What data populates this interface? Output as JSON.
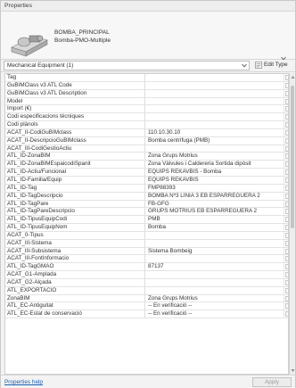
{
  "window": {
    "title": "Properties"
  },
  "type_selector": {
    "family_name": "BOMBA_PRINCIPAL",
    "type_name": "Bomba-PMO-Multiple"
  },
  "filter": {
    "selected": "Mechanical Equipment (1)",
    "edit_type_label": "Edit Type"
  },
  "parameters": [
    {
      "name": "Tag",
      "value": ""
    },
    {
      "name": "GuBIMClass v3 ATL Code",
      "value": ""
    },
    {
      "name": "GuBIMClass v3 ATL Description",
      "value": ""
    },
    {
      "name": "Model",
      "value": ""
    },
    {
      "name": "Import (€)",
      "value": ""
    },
    {
      "name": "Codi especificacions técniques",
      "value": ""
    },
    {
      "name": "Codi plànols",
      "value": ""
    },
    {
      "name": "ACAT_II-CodiGuBIMclass",
      "value": "110.10.30.10"
    },
    {
      "name": "ACAT_II-DescripcioGuBIMclass",
      "value": "Bomba centrífuga (PMB)"
    },
    {
      "name": "ACAT_III-CodiGestioActiu",
      "value": ""
    },
    {
      "name": "ATL_ID-ZonaBIM",
      "value": "Zona Grups Motrius"
    },
    {
      "name": "ATL_ID-ZonaBIMEspaicodiSpanit",
      "value": "Zona Vàlvules i Caldereria Sortida dipòsit"
    },
    {
      "name": "ATL_ID-Actiu/Funcional",
      "value": "EQUIPS REKAVBIS - Bomba"
    },
    {
      "name": "ATL_ID-Familia/Equip",
      "value": "EQUIPS REKAVBIS"
    },
    {
      "name": "ATL_ID-Tag",
      "value": "FMP88393"
    },
    {
      "name": "ATL_ID-TagDescripcio",
      "value": "BOMBA Nº3 LÍNIA 3 EB ESPARREGUERA 2"
    },
    {
      "name": "ATL_ID-TagPare",
      "value": "FB-GFG"
    },
    {
      "name": "ATL_ID-TagPareDescripcio",
      "value": "GRUPS MOTRIUS EB ESPARREGUERA 2"
    },
    {
      "name": "ATL_ID-TipusEquipCodi",
      "value": "PMB"
    },
    {
      "name": "ATL_ID-TipusEquipNom",
      "value": "Bomba"
    },
    {
      "name": "ACAT_0-Tipus",
      "value": ""
    },
    {
      "name": "ACAT_III-Sistema",
      "value": ""
    },
    {
      "name": "ACAT_III-Subsistema",
      "value": "Sistema Bombeig"
    },
    {
      "name": "ACAT_III-FontInformacio",
      "value": ""
    },
    {
      "name": "ATL_ID-TagGMAO",
      "value": "87137"
    },
    {
      "name": "ACAT_G1-Amplada",
      "value": ""
    },
    {
      "name": "ACAT_G2-Alçada",
      "value": ""
    },
    {
      "name": "ATL_EXPORTACIO",
      "value": ""
    },
    {
      "name": "ZonaBIM",
      "value": "Zona Grups Motrius"
    },
    {
      "name": "ATL_EC-Antiguitat",
      "value": "-- En verificació --"
    },
    {
      "name": "ATL_EC-Estat de conservació",
      "value": "-- En verificació --"
    }
  ],
  "footer": {
    "help_link": "Properties help",
    "apply_label": "Apply"
  },
  "colors": {
    "link": "#1a5fb4",
    "grid_line": "#e3e3e3"
  }
}
